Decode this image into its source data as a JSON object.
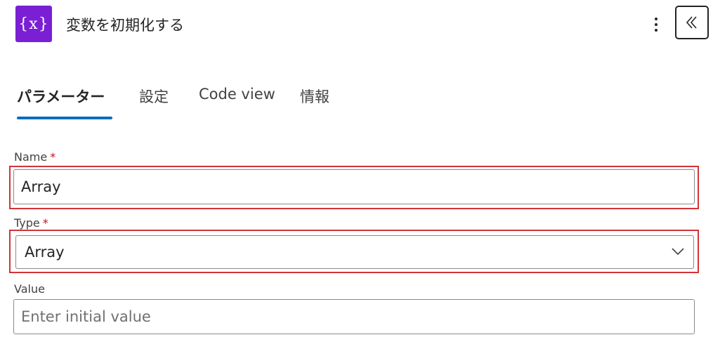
{
  "header": {
    "icon_label": "{x}",
    "title": "変数を初期化する",
    "more_icon": "more-vertical-icon",
    "collapse_icon": "double-chevron-left-icon"
  },
  "tabs": [
    {
      "label": "パラメーター",
      "active": true
    },
    {
      "label": "設定",
      "active": false
    },
    {
      "label": "Code view",
      "active": false
    },
    {
      "label": "情報",
      "active": false
    }
  ],
  "form": {
    "name": {
      "label": "Name",
      "required_mark": "*",
      "value": "Array"
    },
    "type": {
      "label": "Type",
      "required_mark": "*",
      "value": "Array"
    },
    "value": {
      "label": "Value",
      "placeholder": "Enter initial value"
    }
  },
  "colors": {
    "accent": "#0f6cbd",
    "icon_bg": "#7a1fd3",
    "highlight": "#d13438",
    "required": "#c50f1f"
  }
}
